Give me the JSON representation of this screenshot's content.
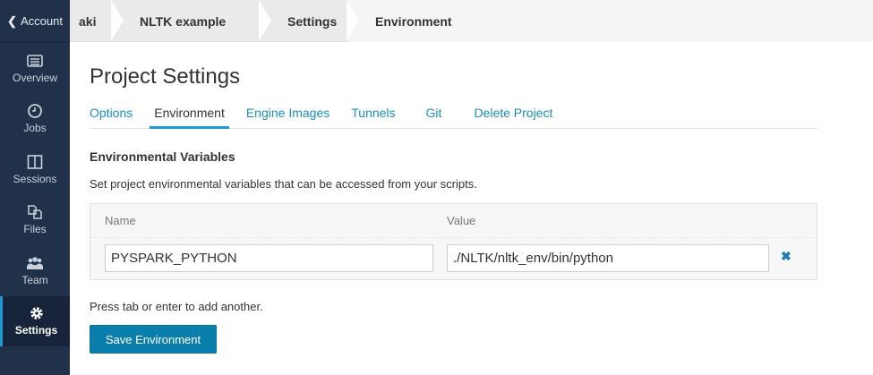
{
  "sidebar": {
    "account": "Account",
    "items": [
      {
        "label": "Overview",
        "icon": "overview-icon"
      },
      {
        "label": "Jobs",
        "icon": "clock-icon"
      },
      {
        "label": "Sessions",
        "icon": "sessions-icon"
      },
      {
        "label": "Files",
        "icon": "files-icon"
      },
      {
        "label": "Team",
        "icon": "team-icon"
      },
      {
        "label": "Settings",
        "icon": "gear-icon",
        "active": true
      }
    ]
  },
  "breadcrumb": [
    "aki",
    "NLTK example",
    "Settings",
    "Environment"
  ],
  "page": {
    "title": "Project Settings",
    "tabs": [
      "Options",
      "Environment",
      "Engine Images",
      "Tunnels",
      "Git",
      "Delete Project"
    ],
    "section_title": "Environmental Variables",
    "description": "Set project environmental variables that can be accessed from your scripts.",
    "columns": {
      "name": "Name",
      "value": "Value"
    },
    "variables": [
      {
        "name": "PYSPARK_PYTHON",
        "value": "./NLTK/nltk_env/bin/python"
      }
    ],
    "delete_glyph": "✖",
    "hint": "Press tab or enter to add another.",
    "save_label": "Save Environment"
  },
  "colors": {
    "sidebar": "#22314a",
    "accent": "#1b9bd1",
    "button": "#0a7fac"
  }
}
